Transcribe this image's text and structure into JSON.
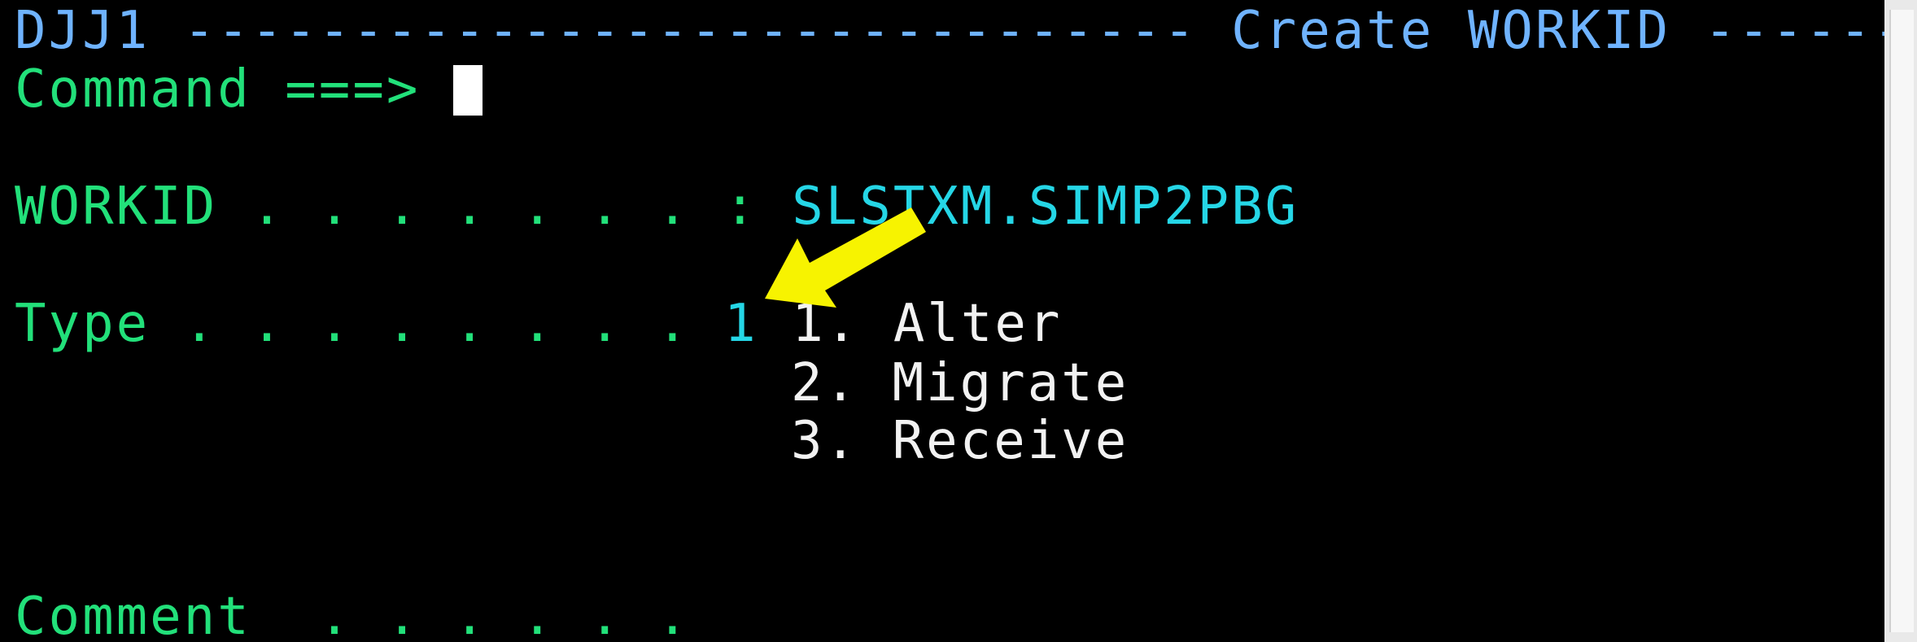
{
  "header": {
    "system_id": "DJJ1",
    "dashes_left": " ------------------------------ ",
    "title": "Create WORKID",
    "dashes_right": " ------"
  },
  "command": {
    "label": "Command ===>",
    "value": ""
  },
  "workid": {
    "label": "WORKID . . . . . . . : ",
    "value": "SLSTXM.SIMP2PBG"
  },
  "type": {
    "label": "Type . . . . . . . . ",
    "value": "1",
    "options": [
      "1. Alter",
      "2. Migrate",
      "3. Receive"
    ]
  },
  "comment": {
    "label": "Comment  . . . . . ."
  },
  "annotation": {
    "arrow_color": "#f7f300"
  },
  "colors": {
    "field_label": "#22e07a",
    "header": "#6fb3ff",
    "value": "#25d6e6",
    "option_text": "#f2f2f2",
    "background": "#000000"
  }
}
